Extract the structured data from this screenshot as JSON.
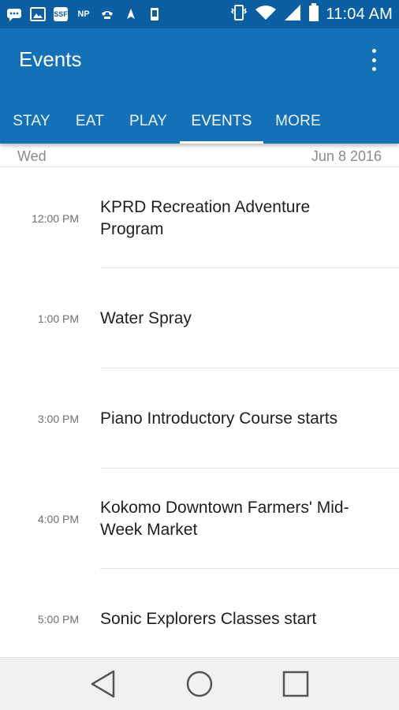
{
  "status_bar": {
    "time": "11:04 AM",
    "notification_icons": [
      "message-icon",
      "image-icon",
      "news-icon",
      "np-icon",
      "phone-icon",
      "navigation-icon",
      "app-icon"
    ],
    "np_label": "NP",
    "news_label": "SSF"
  },
  "app_bar": {
    "title": "Events",
    "tabs": [
      {
        "label": "STAY"
      },
      {
        "label": "EAT"
      },
      {
        "label": "PLAY"
      },
      {
        "label": "EVENTS"
      },
      {
        "label": "MORE"
      }
    ],
    "active_tab": "EVENTS"
  },
  "date_header": {
    "day": "Wed",
    "date": "Jun 8 2016"
  },
  "events": [
    {
      "time": "12:00 PM",
      "title": "KPRD Recreation Adventure Program"
    },
    {
      "time": "1:00 PM",
      "title": "Water Spray"
    },
    {
      "time": "3:00 PM",
      "title": "Piano Introductory Course starts"
    },
    {
      "time": "4:00 PM",
      "title": "Kokomo Downtown Farmers' Mid-Week Market"
    },
    {
      "time": "5:00 PM",
      "title": "Sonic Explorers Classes start"
    }
  ],
  "colors": {
    "status_bar": "#0b5fa0",
    "app_bar": "#1471b7",
    "nav_bar": "#f1f1f1"
  },
  "nav_bar": {
    "buttons": [
      "back-icon",
      "home-icon",
      "recents-icon"
    ]
  }
}
